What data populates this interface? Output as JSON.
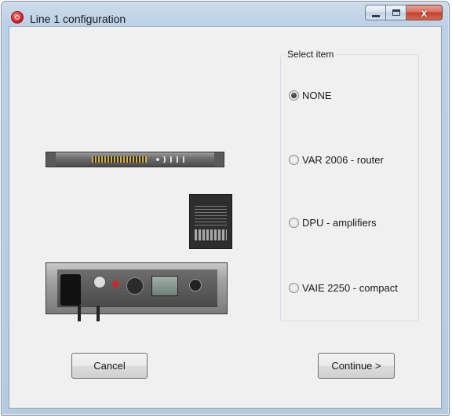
{
  "window": {
    "title": "Line 1 configuration",
    "controls": {
      "minimize_icon": "minimize-icon",
      "maximize_icon": "maximize-icon",
      "close_icon": "close-icon",
      "close_glyph": "x"
    }
  },
  "group": {
    "label": "Select item",
    "options": [
      {
        "label": "NONE",
        "checked": true
      },
      {
        "label": "VAR 2006 - router",
        "checked": false
      },
      {
        "label": "DPU - amplifiers",
        "checked": false
      },
      {
        "label": "VAIE 2250 - compact",
        "checked": false
      }
    ]
  },
  "images": [
    "var-2006-router-image",
    "dpu-amplifier-image",
    "vaie-2250-compact-image"
  ],
  "buttons": {
    "cancel": "Cancel",
    "continue": "Continue >"
  },
  "colors": {
    "title_bar": "#bcd0e6",
    "client_background": "#f0f0f0",
    "close_button": "#c2402b"
  }
}
